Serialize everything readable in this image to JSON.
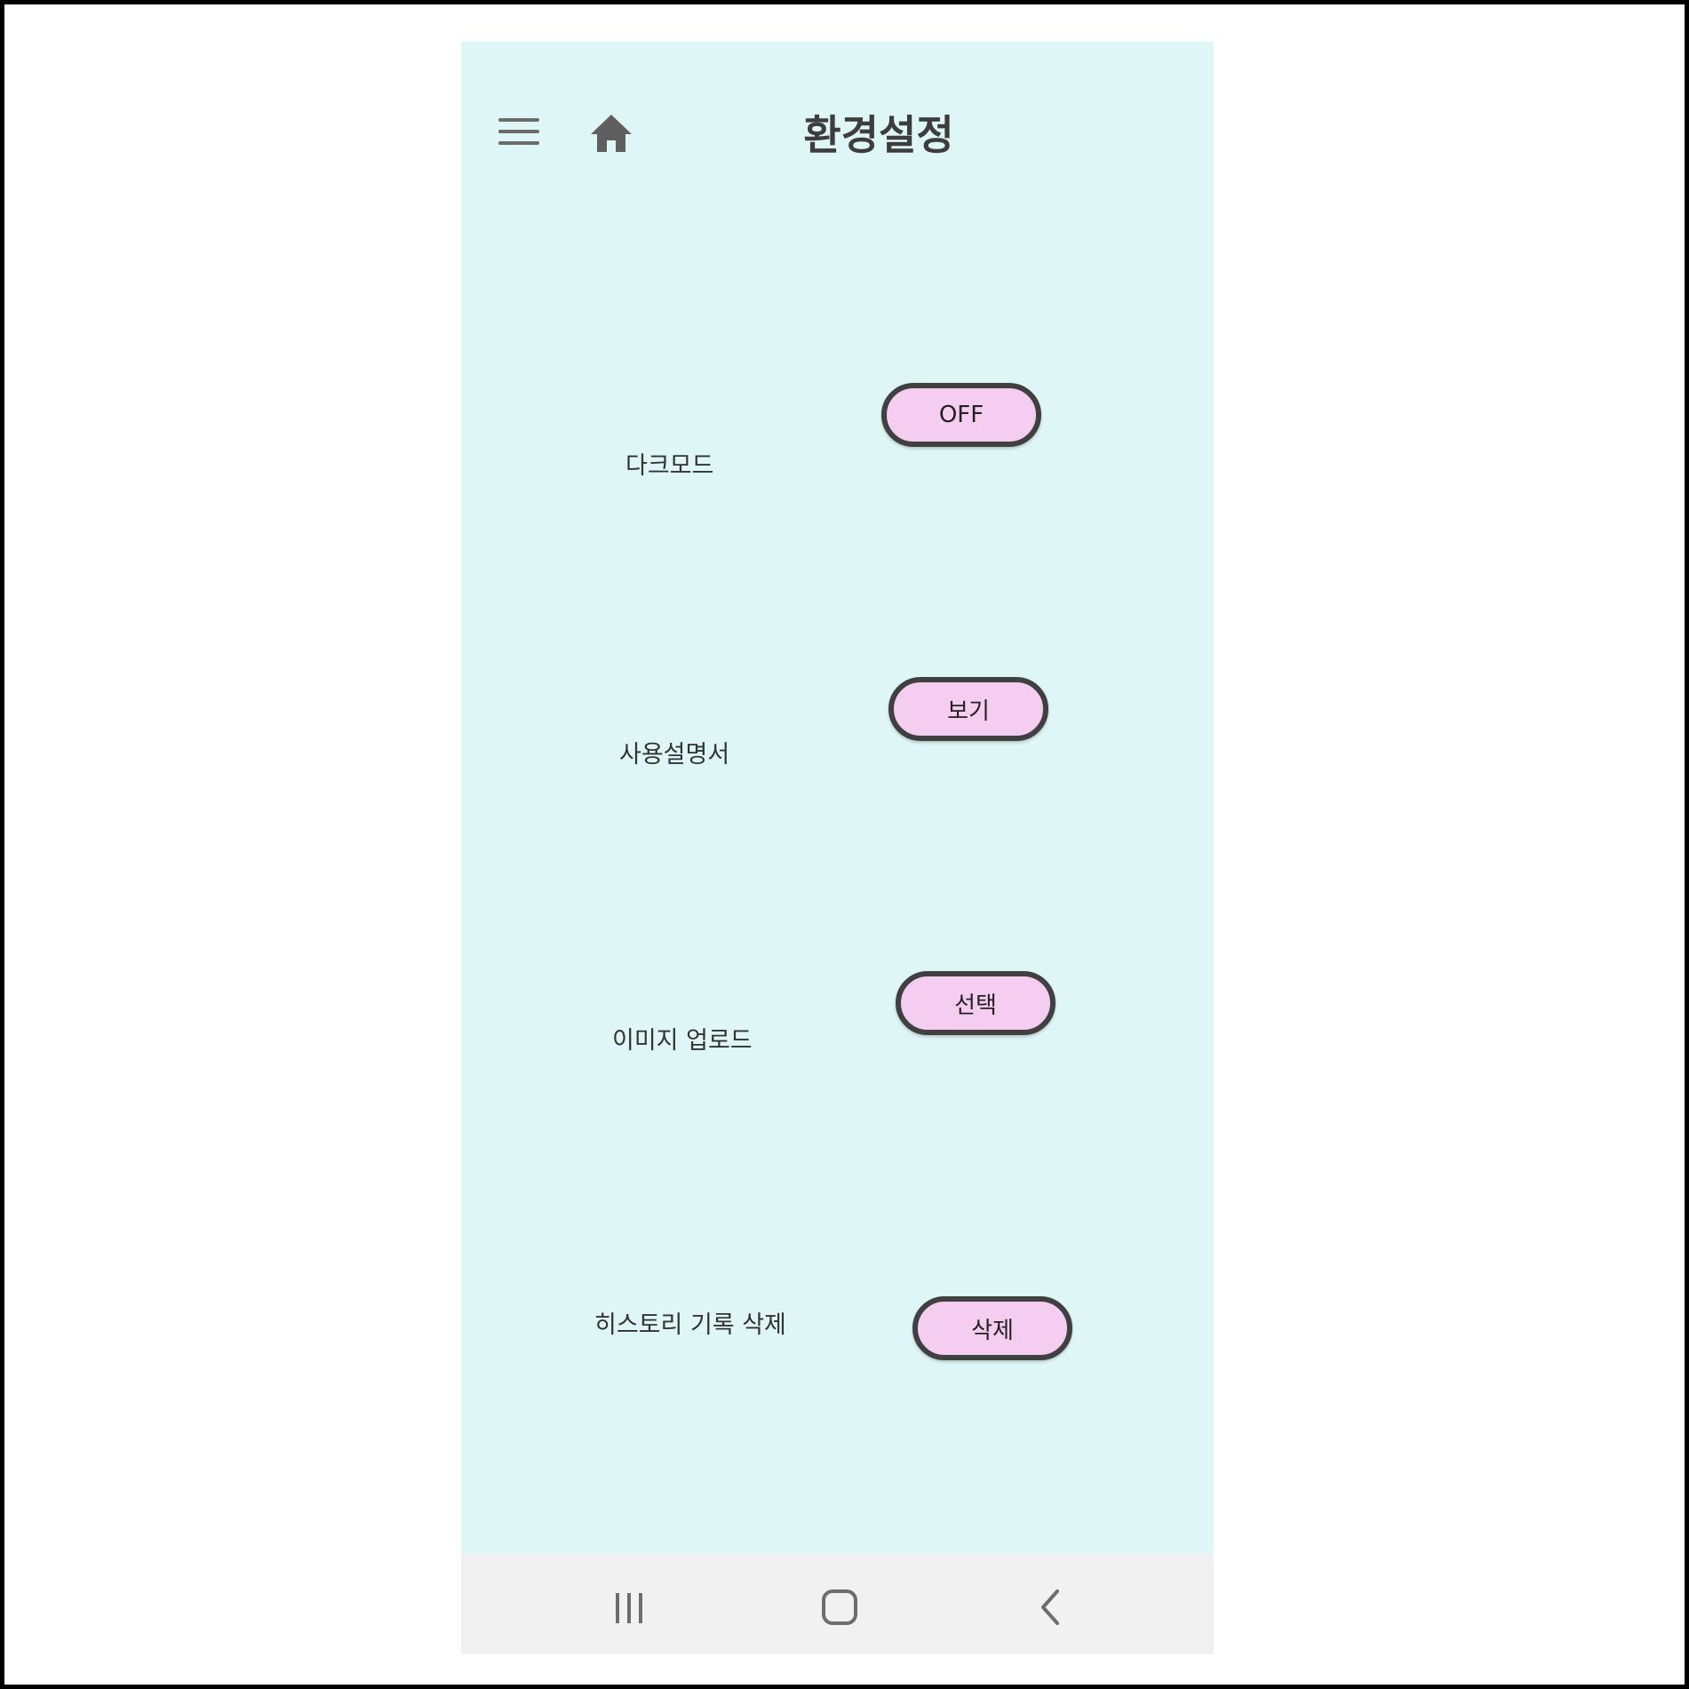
{
  "header": {
    "title": "환경설정",
    "menu_icon": "hamburger-menu-icon",
    "home_icon": "home-icon"
  },
  "settings": {
    "items": [
      {
        "label": "다크모드",
        "button": "OFF"
      },
      {
        "label": "사용설명서",
        "button": "보기"
      },
      {
        "label": "이미지 업로드",
        "button": "선택"
      },
      {
        "label": "히스토리 기록 삭제",
        "button": "삭제"
      }
    ]
  },
  "navbar": {
    "recents_icon": "recents-icon",
    "home_icon": "home-circle-icon",
    "back_icon": "back-chevron-icon"
  },
  "colors": {
    "frame_border": "#000000",
    "screen_background": "#dff6f6",
    "button_fill": "#f4cdf1",
    "button_border": "#404040",
    "navbar_background": "#f1f1f1"
  }
}
